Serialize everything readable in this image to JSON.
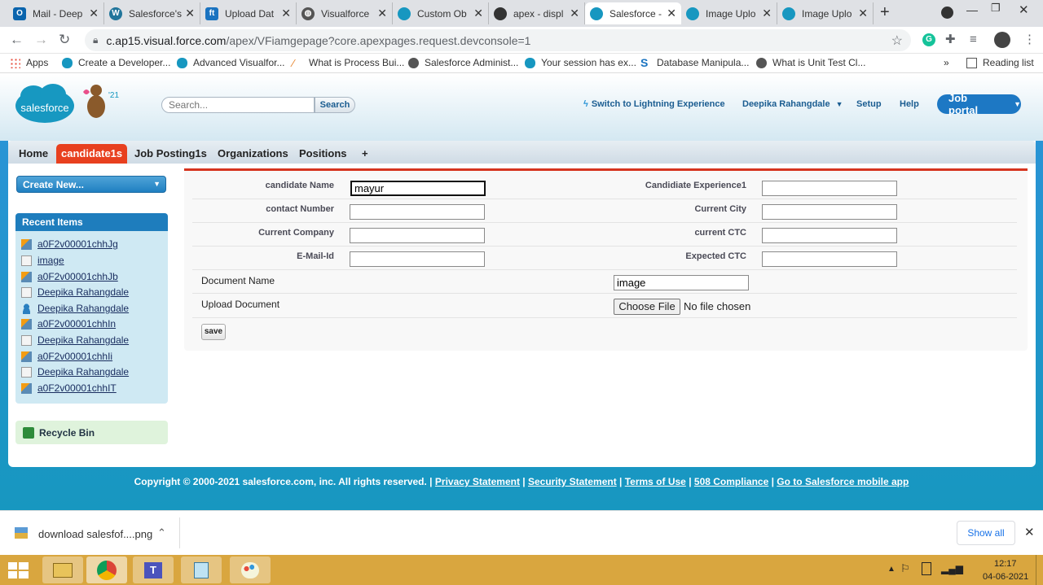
{
  "browser": {
    "tabs": [
      {
        "title": "Mail - Deep",
        "icon": "outlook-icon",
        "color": "#0a64ad"
      },
      {
        "title": "Salesforce's",
        "icon": "wordpress-icon",
        "color": "#21759b"
      },
      {
        "title": "Upload Dat",
        "icon": "ft-icon",
        "color": "#1a73c0"
      },
      {
        "title": "Visualforce",
        "icon": "globe-icon",
        "color": "#444"
      },
      {
        "title": "Custom Ob",
        "icon": "salesforce-cloud-icon",
        "color": "#1797c0"
      },
      {
        "title": "apex - displ",
        "icon": "cloud-icon",
        "color": "#333"
      },
      {
        "title": "Salesforce -",
        "icon": "salesforce-cloud-icon",
        "color": "#1797c0"
      },
      {
        "title": "Image Uplo",
        "icon": "salesforce-cloud-icon",
        "color": "#1797c0"
      },
      {
        "title": "Image Uplo",
        "icon": "salesforce-cloud-icon",
        "color": "#1797c0"
      }
    ],
    "active_tab": 6,
    "new_tab": "+",
    "url_host": "c.ap15.visual.force.com",
    "url_path": "/apex/VFiamgepage?core.apexpages.request.devconsole=1",
    "bookmarks": [
      {
        "label": "Apps"
      },
      {
        "label": "Create a Developer..."
      },
      {
        "label": "Advanced Visualfor..."
      },
      {
        "label": "What is Process Bui..."
      },
      {
        "label": "Salesforce Administ..."
      },
      {
        "label": "Your session has ex..."
      },
      {
        "label": "Database Manipula..."
      },
      {
        "label": "What is Unit Test Cl..."
      }
    ],
    "overflow": "»",
    "reading_list": "Reading list"
  },
  "sf_header": {
    "logo_text": "salesforce",
    "edition": "'21",
    "search_placeholder": "Search...",
    "search_button": "Search",
    "switch_lightning": "Switch to Lightning Experience",
    "user_name": "Deepika Rahangdale",
    "setup": "Setup",
    "help": "Help",
    "app_menu": "Job portal"
  },
  "nav": {
    "tabs": [
      "Home",
      "candidate1s",
      "Job Posting1s",
      "Organizations",
      "Positions",
      "+"
    ],
    "selected": 1
  },
  "sidebar": {
    "create_new": "Create New...",
    "recent_title": "Recent Items",
    "recent_items": [
      {
        "label": "a0F2v00001chhJg",
        "icon": "custom-object-icon"
      },
      {
        "label": "image",
        "icon": "document-icon"
      },
      {
        "label": "a0F2v00001chhJb",
        "icon": "custom-object-icon"
      },
      {
        "label": "Deepika Rahangdale",
        "icon": "document-icon"
      },
      {
        "label": "Deepika Rahangdale",
        "icon": "user-icon"
      },
      {
        "label": "a0F2v00001chhIn",
        "icon": "custom-object-icon"
      },
      {
        "label": "Deepika Rahangdale",
        "icon": "document-icon"
      },
      {
        "label": "a0F2v00001chhIi",
        "icon": "custom-object-icon"
      },
      {
        "label": "Deepika Rahangdale",
        "icon": "document-icon"
      },
      {
        "label": "a0F2v00001chhIT",
        "icon": "custom-object-icon"
      }
    ],
    "recycle_bin": "Recycle Bin"
  },
  "form": {
    "candidate_name_label": "candidate Name",
    "candidate_name_value": "mayur",
    "contact_number_label": "contact Number",
    "contact_number_value": "",
    "current_company_label": "Current Company",
    "current_company_value": "",
    "email_label": "E-Mail-Id",
    "email_value": "",
    "experience_label": "Candidiate Experience1",
    "experience_value": "",
    "current_city_label": "Current City",
    "current_city_value": "",
    "current_ctc_label": "current CTC",
    "current_ctc_value": "",
    "expected_ctc_label": "Expected CTC",
    "expected_ctc_value": "",
    "document_name_label": "Document Name",
    "document_name_value": "image",
    "upload_label": "Upload Document",
    "choose_file": "Choose File",
    "no_file": "No file chosen",
    "save": "save"
  },
  "footer": {
    "copyright": "Copyright © 2000-2021 salesforce.com, inc. All rights reserved. |",
    "links": [
      "Privacy Statement",
      "Security Statement",
      "Terms of Use",
      "508 Compliance",
      "Go to Salesforce mobile app"
    ]
  },
  "download_bar": {
    "file_name": "download salesfof....png",
    "show_all": "Show all"
  },
  "taskbar": {
    "time": "12:17",
    "date": "04-06-2021"
  },
  "colors": {
    "sf_blue": "#1797c0",
    "tab_selected": "#e8401f",
    "taskbar": "#d9a63f"
  }
}
